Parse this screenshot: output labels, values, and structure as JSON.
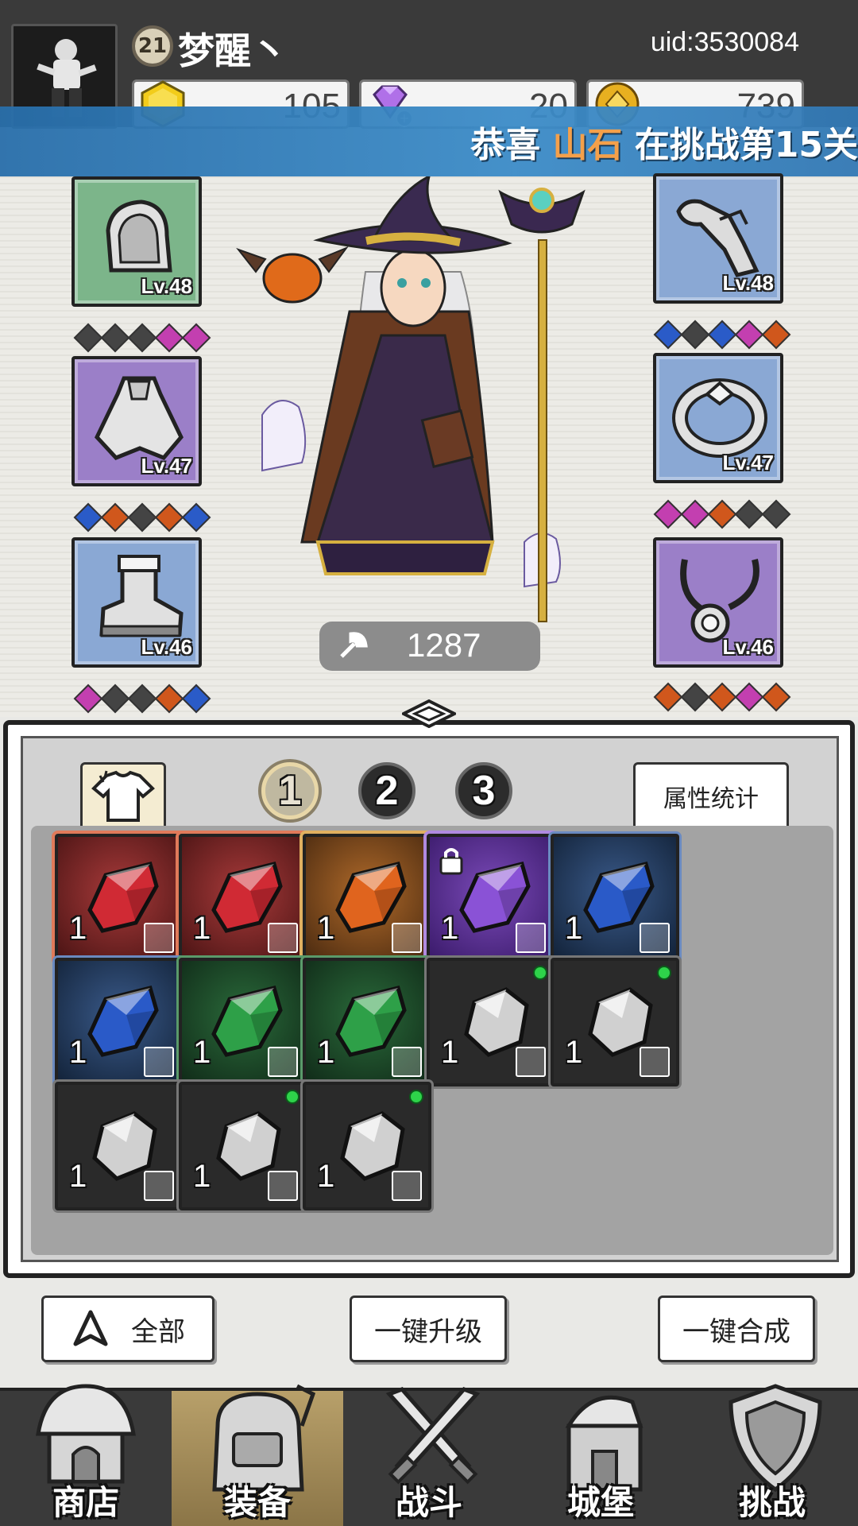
{
  "header": {
    "player_level": "21",
    "player_name": "梦醒丶",
    "uid": "uid:3530084",
    "currencies": [
      {
        "icon": "yellow-gem-icon",
        "value": "105"
      },
      {
        "icon": "diamond-icon",
        "value": "20"
      },
      {
        "icon": "gold-coin-icon",
        "value": "739"
      }
    ]
  },
  "announcement": {
    "prefix": "恭喜",
    "highlight": "山石",
    "suffix": "在挑战第15关"
  },
  "equipment": {
    "left": [
      {
        "name": "helmet",
        "level": "Lv.48",
        "rarity": "green",
        "gems": [
          "#444",
          "#444",
          "#444",
          "#c33fb0",
          "#c33fb0"
        ]
      },
      {
        "name": "armor",
        "level": "Lv.47",
        "rarity": "purple",
        "gems": [
          "#2a5bc8",
          "#d0571c",
          "#444",
          "#d0571c",
          "#2a5bc8"
        ]
      },
      {
        "name": "boots",
        "level": "Lv.46",
        "rarity": "blue",
        "gems": [
          "#c33fb0",
          "#444",
          "#444",
          "#d0571c",
          "#2a5bc8"
        ]
      }
    ],
    "right": [
      {
        "name": "gloves",
        "level": "Lv.48",
        "rarity": "blue",
        "gems": [
          "#2a5bc8",
          "#444",
          "#2a5bc8",
          "#c33fb0",
          "#d0571c"
        ]
      },
      {
        "name": "ring",
        "level": "Lv.47",
        "rarity": "blue",
        "gems": [
          "#c33fb0",
          "#c33fb0",
          "#d0571c",
          "#444",
          "#444"
        ]
      },
      {
        "name": "necklace",
        "level": "Lv.46",
        "rarity": "purple",
        "gems": [
          "#d0571c",
          "#444",
          "#d0571c",
          "#c33fb0",
          "#d0571c"
        ]
      }
    ]
  },
  "power": "1287",
  "inventory": {
    "pages": [
      "1",
      "2",
      "3"
    ],
    "active_page": "1",
    "stats_button": "属性统计",
    "items": [
      {
        "color": "red",
        "count": "1",
        "gem": "#d02a34",
        "locked": false,
        "new": false
      },
      {
        "color": "red",
        "count": "1",
        "gem": "#d02a34",
        "locked": false,
        "new": false
      },
      {
        "color": "orange",
        "count": "1",
        "gem": "#e0641e",
        "locked": false,
        "new": false
      },
      {
        "color": "purple",
        "count": "1",
        "gem": "#8a52d6",
        "locked": true,
        "new": false
      },
      {
        "color": "blue",
        "count": "1",
        "gem": "#2a5ac8",
        "locked": false,
        "new": false
      },
      {
        "color": "blue",
        "count": "1",
        "gem": "#2a5ac8",
        "locked": false,
        "new": false
      },
      {
        "color": "green",
        "count": "1",
        "gem": "#2ea048",
        "locked": false,
        "new": false
      },
      {
        "color": "green",
        "count": "1",
        "gem": "#2ea048",
        "locked": false,
        "new": false
      },
      {
        "color": "grey",
        "count": "1",
        "gem": "#d0d0d0",
        "locked": false,
        "new": true
      },
      {
        "color": "grey",
        "count": "1",
        "gem": "#d0d0d0",
        "locked": false,
        "new": true
      },
      {
        "color": "grey",
        "count": "1",
        "gem": "#d0d0d0",
        "locked": false,
        "new": false
      },
      {
        "color": "grey",
        "count": "1",
        "gem": "#d0d0d0",
        "locked": false,
        "new": true
      },
      {
        "color": "grey",
        "count": "1",
        "gem": "#d0d0d0",
        "locked": false,
        "new": true
      }
    ]
  },
  "actions": {
    "filter_all": "全部",
    "upgrade_all": "一键升级",
    "merge_all": "一键合成"
  },
  "nav": [
    {
      "label": "商店",
      "icon": "shop-icon",
      "active": false
    },
    {
      "label": "装备",
      "icon": "backpack-icon",
      "active": true
    },
    {
      "label": "战斗",
      "icon": "crossed-swords-icon",
      "active": false
    },
    {
      "label": "城堡",
      "icon": "castle-icon",
      "active": false
    },
    {
      "label": "挑战",
      "icon": "shield-icon",
      "active": false
    }
  ]
}
